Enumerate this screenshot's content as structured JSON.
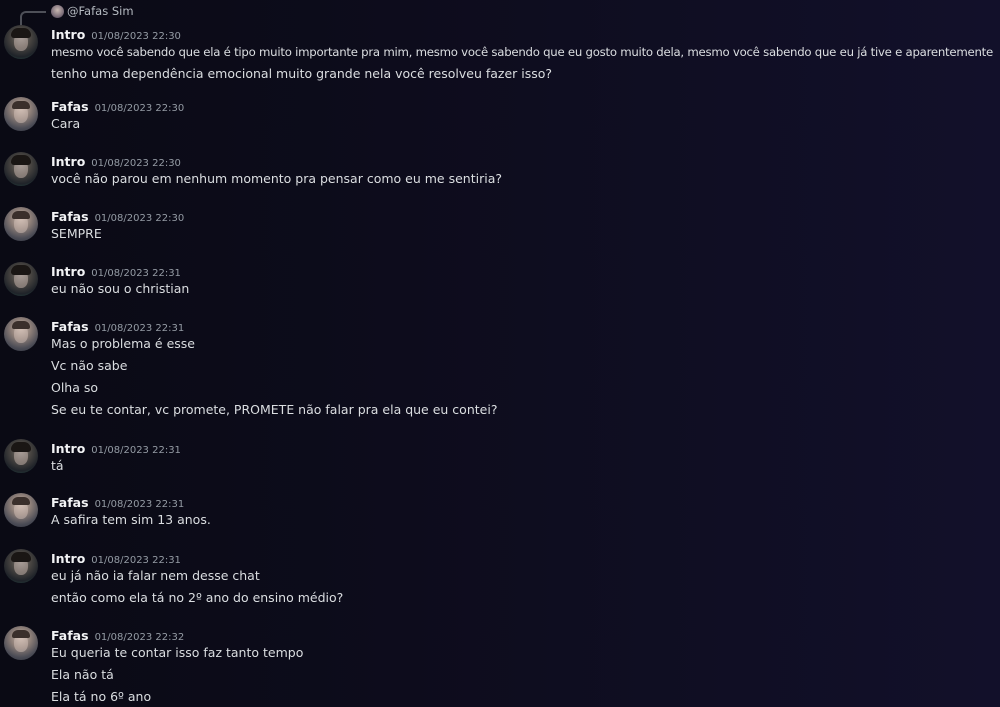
{
  "reply_reference": {
    "text": "@Fafas Sim"
  },
  "messages": [
    {
      "author": "Intro",
      "avatar_icon": "intro-avatar",
      "timestamp": "01/08/2023 22:30",
      "lines": [
        "mesmo você sabendo que ela é tipo muito importante pra mim, mesmo você sabendo que eu gosto muito dela, mesmo você sabendo que eu já tive e aparentemente",
        "tenho uma dependência emocional muito grande nela você resolveu fazer isso?"
      ]
    },
    {
      "author": "Fafas",
      "avatar_icon": "fafas-avatar",
      "timestamp": "01/08/2023 22:30",
      "lines": [
        "Cara"
      ]
    },
    {
      "author": "Intro",
      "avatar_icon": "intro-avatar",
      "timestamp": "01/08/2023 22:30",
      "lines": [
        "você não parou em nenhum momento pra pensar como eu me sentiria?"
      ]
    },
    {
      "author": "Fafas",
      "avatar_icon": "fafas-avatar",
      "timestamp": "01/08/2023 22:30",
      "lines": [
        "SEMPRE"
      ]
    },
    {
      "author": "Intro",
      "avatar_icon": "intro-avatar",
      "timestamp": "01/08/2023 22:31",
      "lines": [
        "eu não sou o christian"
      ]
    },
    {
      "author": "Fafas",
      "avatar_icon": "fafas-avatar",
      "timestamp": "01/08/2023 22:31",
      "lines": [
        "Mas o problema é esse",
        "Vc não sabe",
        "Olha so",
        "Se eu te contar, vc promete, PROMETE não falar pra ela que eu contei?"
      ]
    },
    {
      "author": "Intro",
      "avatar_icon": "intro-avatar",
      "timestamp": "01/08/2023 22:31",
      "lines": [
        "tá"
      ]
    },
    {
      "author": "Fafas",
      "avatar_icon": "fafas-avatar",
      "timestamp": "01/08/2023 22:31",
      "lines": [
        "A safira tem sim 13 anos."
      ]
    },
    {
      "author": "Intro",
      "avatar_icon": "intro-avatar",
      "timestamp": "01/08/2023 22:31",
      "lines": [
        "eu já não ia falar nem desse chat",
        "então como ela tá no 2º ano do ensino médio?"
      ]
    },
    {
      "author": "Fafas",
      "avatar_icon": "fafas-avatar",
      "timestamp": "01/08/2023 22:32",
      "lines": [
        "Eu queria te contar isso faz tanto tempo",
        "Ela não tá",
        "Ela tá no 6º ano"
      ]
    }
  ]
}
